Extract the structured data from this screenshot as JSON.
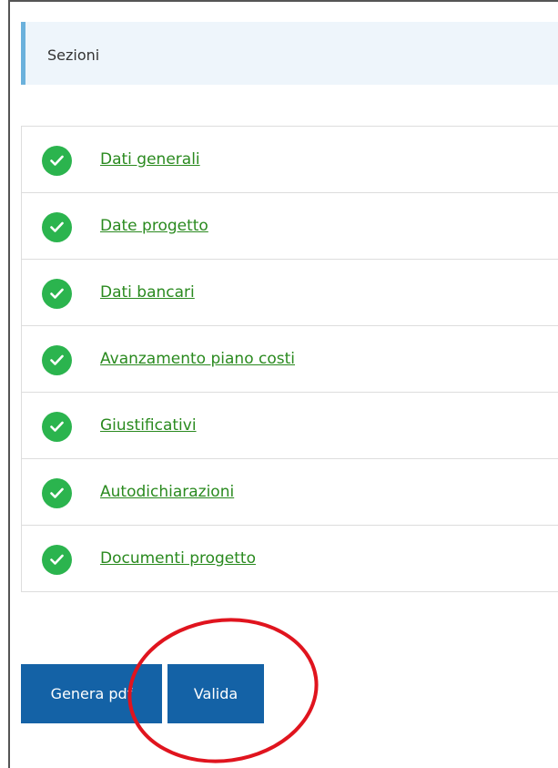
{
  "header": {
    "title": "Sezioni"
  },
  "sections": [
    {
      "label": "Dati generali",
      "status": "complete"
    },
    {
      "label": "Date progetto",
      "status": "complete"
    },
    {
      "label": "Dati bancari",
      "status": "complete"
    },
    {
      "label": "Avanzamento piano costi",
      "status": "complete"
    },
    {
      "label": "Giustificativi",
      "status": "complete"
    },
    {
      "label": "Autodichiarazioni",
      "status": "complete"
    },
    {
      "label": "Documenti progetto",
      "status": "complete"
    }
  ],
  "actions": {
    "generate_pdf_label": "Genera pdf",
    "validate_label": "Valida"
  },
  "colors": {
    "check_green": "#2bb44e",
    "link_green": "#2a8a1f",
    "button_blue": "#1462a6",
    "header_bg": "#eef5fb",
    "header_accent": "#6bb1dc",
    "annotation_red": "#e0141e"
  },
  "icons": {
    "status": "check-circle-icon"
  }
}
